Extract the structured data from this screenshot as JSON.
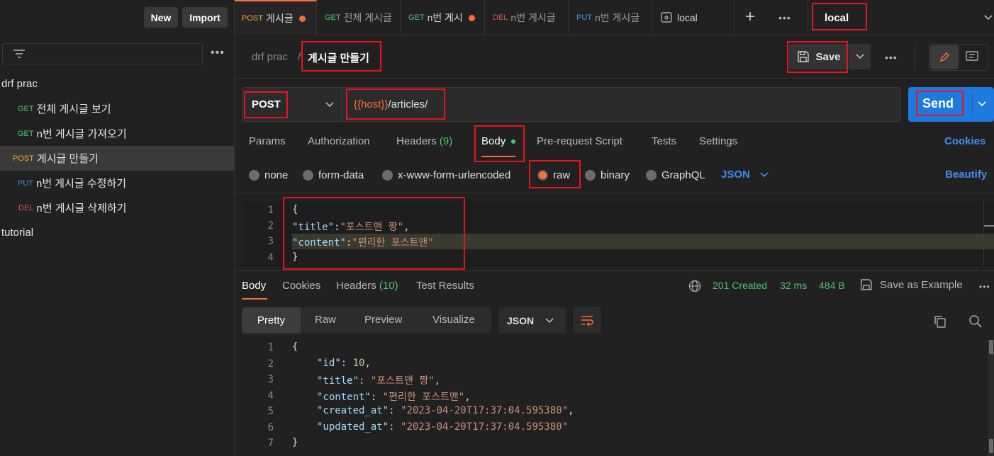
{
  "sidebar": {
    "new_label": "New",
    "import_label": "Import",
    "collections": [
      {
        "name": "drf prac"
      },
      {
        "name": "tutorial"
      }
    ],
    "items": [
      {
        "method": "GET",
        "label": "전체 게시글 보기"
      },
      {
        "method": "GET",
        "label": "n번 게시글 가져오기"
      },
      {
        "method": "POST",
        "label": "게시글 만들기"
      },
      {
        "method": "PUT",
        "label": "n번 게시글 수정하기"
      },
      {
        "method": "DEL",
        "label": "n번 게시글 삭제하기"
      }
    ]
  },
  "tabs": [
    {
      "method": "POST",
      "label": "게시글"
    },
    {
      "method": "GET",
      "label": "전체 게시글"
    },
    {
      "method": "GET",
      "label": "n번 게시"
    },
    {
      "method": "DEL",
      "label": "n번 게시글"
    },
    {
      "method": "PUT",
      "label": "n번 게시글"
    },
    {
      "label": "local"
    }
  ],
  "environment": "local",
  "request": {
    "breadcrumb_parent": "drf prac",
    "breadcrumb_sep": "/",
    "title": "게시글 만들기",
    "save_label": "Save",
    "method": "POST",
    "url_var": "{{host}}",
    "url_path": "/articles/",
    "send_label": "Send",
    "subtabs": {
      "params": "Params",
      "authorization": "Authorization",
      "headers": "Headers",
      "headers_count": "(9)",
      "body": "Body",
      "prerequest": "Pre-request Script",
      "tests": "Tests",
      "settings": "Settings",
      "cookies": "Cookies"
    },
    "body_types": {
      "none": "none",
      "formdata": "form-data",
      "urlencoded": "x-www-form-urlencoded",
      "raw": "raw",
      "binary": "binary",
      "graphql": "GraphQL",
      "format": "JSON",
      "beautify": "Beautify"
    },
    "body_lines": [
      {
        "num": "1",
        "text": "{"
      },
      {
        "num": "2",
        "key": "\"title\"",
        "sep": ":",
        "val": "\"포스트맨 짱\"",
        "end": ","
      },
      {
        "num": "3",
        "key": "\"content\"",
        "sep": ":",
        "val": "\"편리한 포스트맨\"",
        "end": ""
      },
      {
        "num": "4",
        "text": "}"
      }
    ]
  },
  "response": {
    "tabs": {
      "body": "Body",
      "cookies": "Cookies",
      "headers": "Headers",
      "headers_count": "(10)",
      "test_results": "Test Results"
    },
    "status": "201 Created",
    "time": "32 ms",
    "size": "484 B",
    "save_example": "Save as Example",
    "views": {
      "pretty": "Pretty",
      "raw": "Raw",
      "preview": "Preview",
      "visualize": "Visualize",
      "format": "JSON"
    },
    "lines": [
      {
        "num": "1",
        "text": "{"
      },
      {
        "num": "2",
        "key": "\"id\"",
        "val": "10",
        "type": "n",
        "end": ","
      },
      {
        "num": "3",
        "key": "\"title\"",
        "val": "\"포스트맨 짱\"",
        "type": "s",
        "end": ","
      },
      {
        "num": "4",
        "key": "\"content\"",
        "val": "\"편리한 포스트맨\"",
        "type": "s",
        "end": ","
      },
      {
        "num": "5",
        "key": "\"created_at\"",
        "val": "\"2023-04-20T17:37:04.595380\"",
        "type": "s",
        "end": ","
      },
      {
        "num": "6",
        "key": "\"updated_at\"",
        "val": "\"2023-04-20T17:37:04.595380\"",
        "type": "s",
        "end": ""
      },
      {
        "num": "7",
        "text": "}"
      }
    ]
  },
  "colors": {
    "accent": "#ff6c37",
    "send": "#1f7ae0",
    "highlight": "#e8141c",
    "success": "#4fc46a"
  }
}
